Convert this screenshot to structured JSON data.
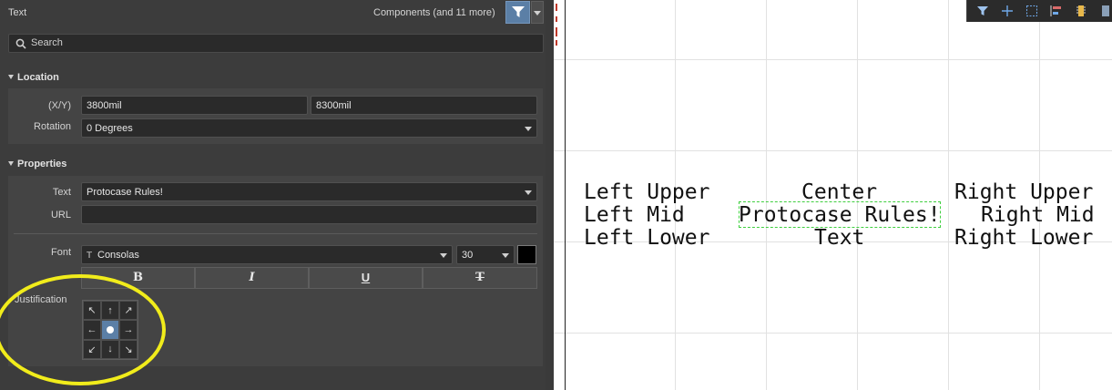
{
  "panel": {
    "title": "Text",
    "components_label": "Components (and 11 more)",
    "search_placeholder": "Search"
  },
  "location": {
    "section_title": "Location",
    "xy_label": "(X/Y)",
    "x_value": "3800mil",
    "y_value": "8300mil",
    "rotation_label": "Rotation",
    "rotation_value": "0 Degrees"
  },
  "properties": {
    "section_title": "Properties",
    "text_label": "Text",
    "text_value": "Protocase Rules!",
    "url_label": "URL",
    "url_value": "",
    "font_label": "Font",
    "font_value": "Consolas",
    "font_icon_glyph": "T",
    "size_value": "30",
    "color": "#000000",
    "bold_label": "B",
    "italic_label": "I",
    "underline_label": "U",
    "strike_label": "T",
    "justification_label": "Justification",
    "justification_selected": "center-center",
    "justification_cells": [
      "↖",
      "↑",
      "↗",
      "←",
      "",
      "→",
      "↙",
      "↓",
      "↘"
    ]
  },
  "canvas": {
    "row1": {
      "left": "Left Upper",
      "center": "Center",
      "right": "Right Upper"
    },
    "row2": {
      "left": "Left Mid",
      "center": "Protocase Rules!",
      "right": "Right Mid"
    },
    "row3": {
      "left": "Left Lower",
      "center": "Text",
      "right": "Right Lower"
    },
    "toolbar_icons": [
      "filter-icon",
      "crosshair-icon",
      "select-rect-icon",
      "align-icon",
      "component-icon"
    ]
  },
  "colors": {
    "panel_bg": "#3c3c3c",
    "accent": "#5b7fa6",
    "highlight": "#f1ec1b",
    "selection": "#3fcf3f"
  }
}
